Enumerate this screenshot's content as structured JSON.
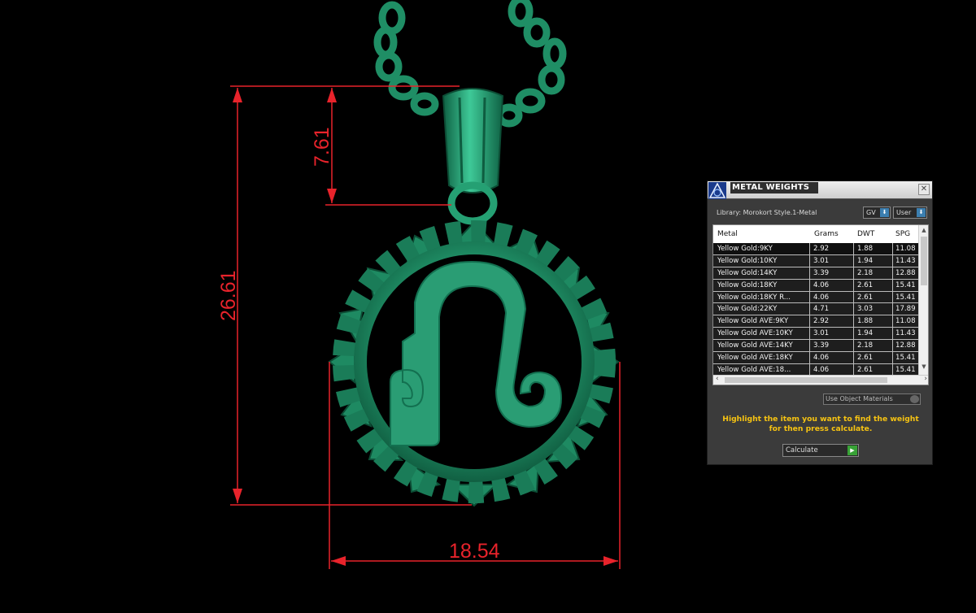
{
  "dimensions": {
    "height_total": "26.61",
    "bail_height": "7.61",
    "width": "18.54"
  },
  "colors": {
    "dimension_line": "#e8232b",
    "model_fill": "#1e8a62",
    "model_highlight": "#3ec997",
    "background": "#000000",
    "instruction_text": "#f6c312"
  },
  "panel": {
    "title": "METAL WEIGHTS",
    "close_icon": "close-icon",
    "library_label": "Library: Morokort Style.1-Metal",
    "gv_label": "GV",
    "user_label": "User",
    "columns": [
      "Metal",
      "Grams",
      "DWT",
      "SPG"
    ],
    "rows": [
      {
        "metal": "Yellow Gold:9KY",
        "grams": "2.92",
        "dwt": "1.88",
        "spg": "11.08"
      },
      {
        "metal": "Yellow Gold:10KY",
        "grams": "3.01",
        "dwt": "1.94",
        "spg": "11.43"
      },
      {
        "metal": "Yellow Gold:14KY",
        "grams": "3.39",
        "dwt": "2.18",
        "spg": "12.88"
      },
      {
        "metal": "Yellow Gold:18KY",
        "grams": "4.06",
        "dwt": "2.61",
        "spg": "15.41"
      },
      {
        "metal": "Yellow Gold:18KY R...",
        "grams": "4.06",
        "dwt": "2.61",
        "spg": "15.41"
      },
      {
        "metal": "Yellow Gold:22KY",
        "grams": "4.71",
        "dwt": "3.03",
        "spg": "17.89"
      },
      {
        "metal": "Yellow Gold AVE:9KY",
        "grams": "2.92",
        "dwt": "1.88",
        "spg": "11.08"
      },
      {
        "metal": "Yellow Gold AVE:10KY",
        "grams": "3.01",
        "dwt": "1.94",
        "spg": "11.43"
      },
      {
        "metal": "Yellow Gold AVE:14KY",
        "grams": "3.39",
        "dwt": "2.18",
        "spg": "12.88"
      },
      {
        "metal": "Yellow Gold AVE:18KY",
        "grams": "4.06",
        "dwt": "2.61",
        "spg": "15.41"
      },
      {
        "metal": "Yellow Gold AVE:18...",
        "grams": "4.06",
        "dwt": "2.61",
        "spg": "15.41"
      }
    ],
    "use_object_materials": "Use Object Materials",
    "instructions": "Highlight the item you want to find the weight for then press calculate.",
    "calculate_label": "Calculate"
  }
}
